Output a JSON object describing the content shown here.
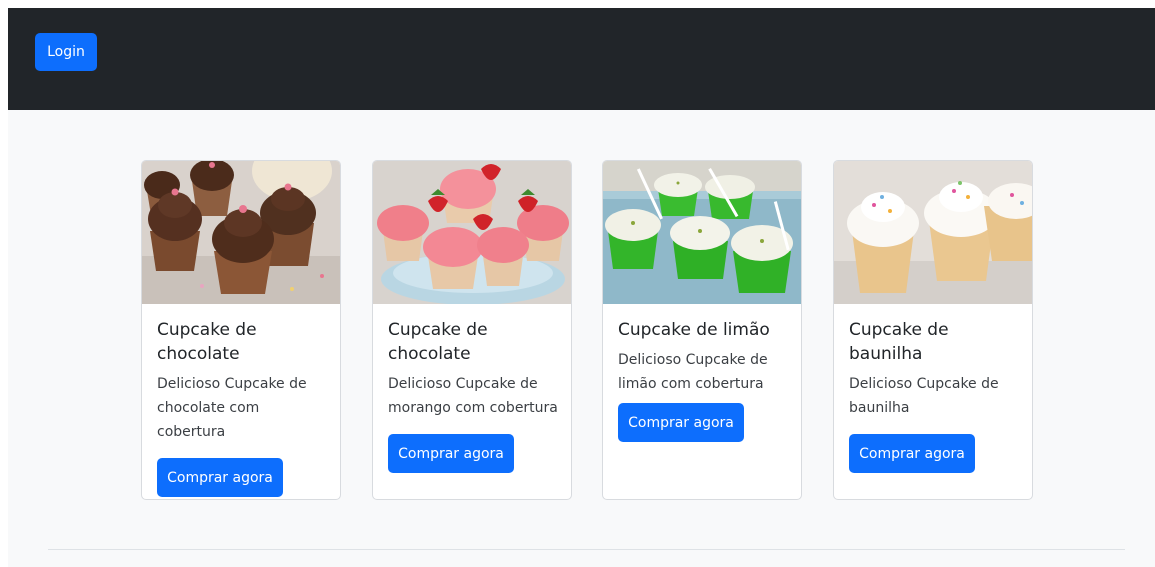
{
  "navbar": {
    "login_label": "Login"
  },
  "products": [
    {
      "title": "Cupcake de chocolate",
      "description": "Delicioso Cupcake de chocolate com cobertura",
      "button_label": "Comprar agora",
      "image": "chocolate-cupcakes-photo"
    },
    {
      "title": "Cupcake de chocolate",
      "description": "Delicioso Cupcake de morango com cobertura",
      "button_label": "Comprar agora",
      "image": "strawberry-cupcakes-photo"
    },
    {
      "title": "Cupcake de limão",
      "description": "Delicioso Cupcake de limão com cobertura",
      "button_label": "Comprar agora",
      "image": "lemon-cupcakes-photo"
    },
    {
      "title": "Cupcake de baunilha",
      "description": "Delicioso Cupcake de baunilha",
      "button_label": "Comprar agora",
      "image": "vanilla-cupcakes-photo"
    }
  ],
  "colors": {
    "navbar_bg": "#212529",
    "primary": "#0d6efd",
    "page_bg": "#f8f9fa"
  }
}
